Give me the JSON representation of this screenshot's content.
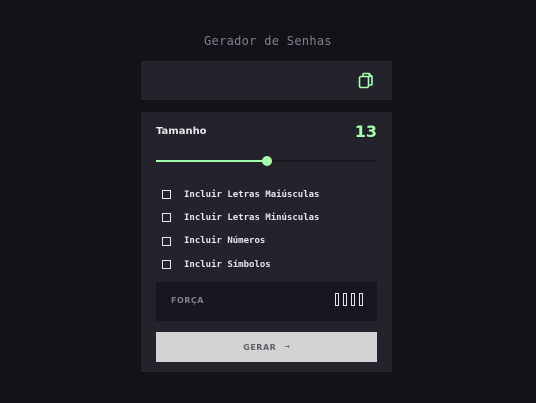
{
  "app": {
    "title": "Gerador de Senhas"
  },
  "output": {
    "password": "",
    "copy_icon": "copy-icon"
  },
  "length": {
    "label": "Tamanho",
    "value": "13",
    "slider_fraction": 0.5
  },
  "options": [
    {
      "label": "Incluir Letras Maiúsculas",
      "checked": false
    },
    {
      "label": "Incluir Letras Minúsculas",
      "checked": false
    },
    {
      "label": "Incluir Números",
      "checked": false
    },
    {
      "label": "Incluir Símbolos",
      "checked": false
    }
  ],
  "strength": {
    "label": "FORÇA",
    "level_text": "",
    "filled_bars": 0,
    "total_bars": 4
  },
  "generate": {
    "label": "GERAR",
    "arrow": "→"
  },
  "colors": {
    "accent": "#a4ffaf",
    "panel": "#24232c",
    "background": "#131217"
  }
}
